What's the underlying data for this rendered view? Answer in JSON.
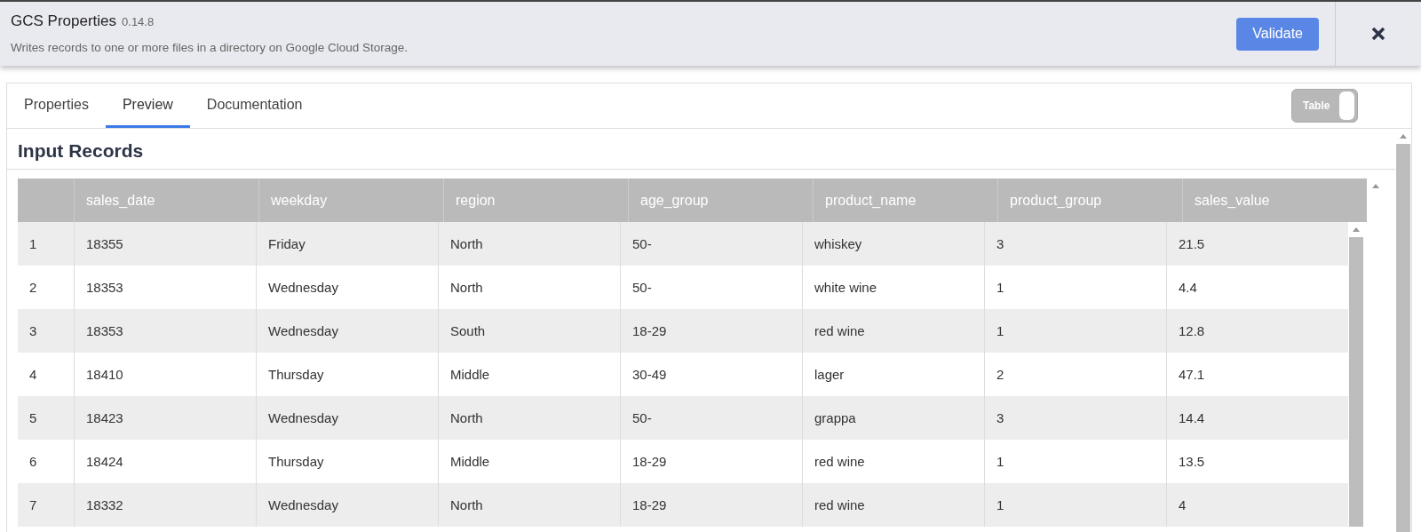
{
  "header": {
    "title": "GCS Properties",
    "version": "0.14.8",
    "description": "Writes records to one or more files in a directory on Google Cloud Storage.",
    "validate_label": "Validate"
  },
  "tabs": [
    {
      "label": "Properties",
      "selected": false
    },
    {
      "label": "Preview",
      "selected": true
    },
    {
      "label": "Documentation",
      "selected": false
    }
  ],
  "view_toggle": {
    "label": "Table",
    "on": true
  },
  "section_title": "Input Records",
  "table": {
    "columns": [
      "",
      "sales_date",
      "weekday",
      "region",
      "age_group",
      "product_name",
      "product_group",
      "sales_value"
    ],
    "rows": [
      [
        "1",
        "18355",
        "Friday",
        "North",
        "50-",
        "whiskey",
        "3",
        "21.5"
      ],
      [
        "2",
        "18353",
        "Wednesday",
        "North",
        "50-",
        "white wine",
        "1",
        "4.4"
      ],
      [
        "3",
        "18353",
        "Wednesday",
        "South",
        "18-29",
        "red wine",
        "1",
        "12.8"
      ],
      [
        "4",
        "18410",
        "Thursday",
        "Middle",
        "30-49",
        "lager",
        "2",
        "47.1"
      ],
      [
        "5",
        "18423",
        "Wednesday",
        "North",
        "50-",
        "grappa",
        "3",
        "14.4"
      ],
      [
        "6",
        "18424",
        "Thursday",
        "Middle",
        "18-29",
        "red wine",
        "1",
        "13.5"
      ],
      [
        "7",
        "18332",
        "Wednesday",
        "North",
        "18-29",
        "red wine",
        "1",
        "4"
      ]
    ]
  }
}
